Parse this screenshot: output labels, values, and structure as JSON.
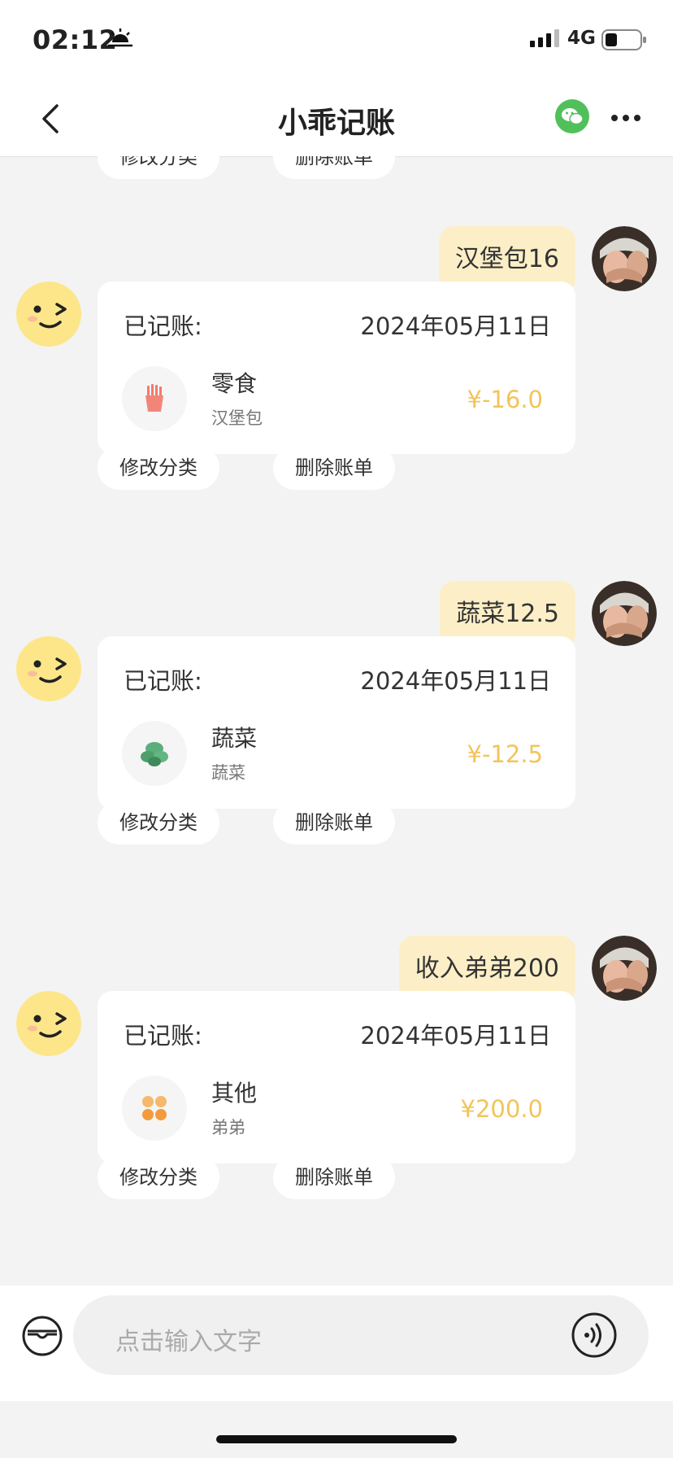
{
  "status": {
    "time": "02:12",
    "network": "4G"
  },
  "nav": {
    "title": "小乖记账"
  },
  "actions": {
    "edit": "修改分类",
    "delete": "删除账单"
  },
  "messages": [
    {
      "user_text": "汉堡包16",
      "record_label": "已记账:",
      "date": "2024年05月11日",
      "category": "零食",
      "note": "汉堡包",
      "amount": "¥-16.0",
      "icon": "french-fries-icon"
    },
    {
      "user_text": "蔬菜12.5",
      "record_label": "已记账:",
      "date": "2024年05月11日",
      "category": "蔬菜",
      "note": "蔬菜",
      "amount": "¥-12.5",
      "icon": "vegetable-icon"
    },
    {
      "user_text": "收入弟弟200",
      "record_label": "已记账:",
      "date": "2024年05月11日",
      "category": "其他",
      "note": "弟弟",
      "amount": "¥200.0",
      "icon": "grid-other-icon"
    }
  ],
  "input": {
    "placeholder": "点击输入文字"
  },
  "colors": {
    "accent": "#f2c45a",
    "bubble": "#fcefc7",
    "wechat": "#52c05a"
  }
}
